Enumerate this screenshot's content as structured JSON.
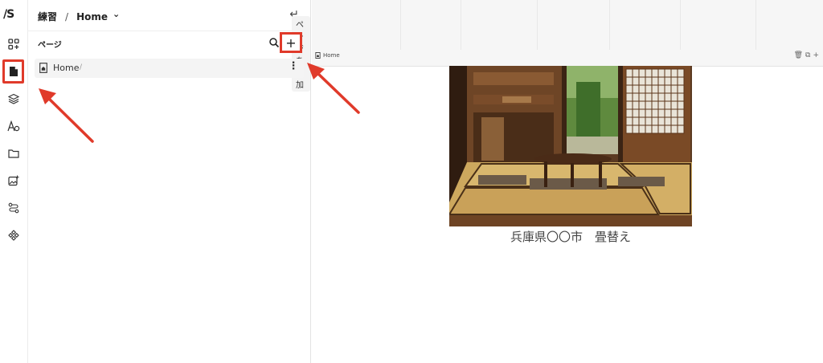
{
  "rail": {
    "logo": "/S",
    "items": [
      "add-element-icon",
      "pages-icon",
      "layers-icon",
      "typography-icon",
      "folder-icon",
      "image-add-icon",
      "flow-icon",
      "components-icon"
    ]
  },
  "panel": {
    "breadcrumb_project": "練習",
    "breadcrumb_sep": "/",
    "breadcrumb_page": "Home",
    "chevron": "⌄",
    "back": "↵",
    "section_title": "ページ",
    "add_label": "+",
    "tooltip": "ページを追加",
    "pages": [
      {
        "name": "Home",
        "slug": "/"
      }
    ],
    "more": "⋮"
  },
  "canvas": {
    "frame_label": "Home",
    "caption": "兵庫県〇〇市　畳替え"
  },
  "colors": {
    "highlight": "#e03a2a"
  }
}
